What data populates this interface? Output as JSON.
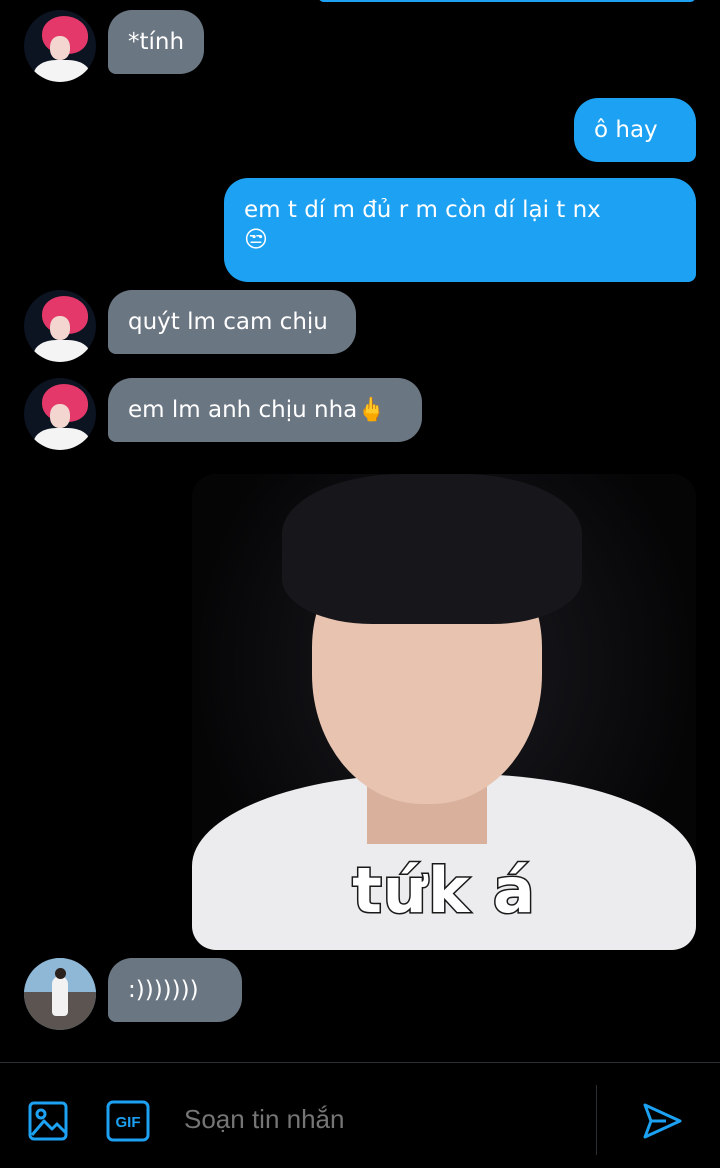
{
  "messages": [
    {
      "side": "received",
      "text": "*tính"
    },
    {
      "side": "sent",
      "text": "ô hay"
    },
    {
      "side": "sent",
      "line1": "em t dí m đủ r m còn dí lại t nx",
      "line2": "😒"
    },
    {
      "side": "received",
      "text": "quýt lm cam chịu"
    },
    {
      "side": "received",
      "text": "em lm anh chịu nha🖕"
    },
    {
      "side": "sent",
      "type": "image",
      "caption": "tứk á"
    },
    {
      "side": "received",
      "text": ":)))))))"
    }
  ],
  "composer": {
    "placeholder": "Soạn tin nhắn",
    "gif_label": "GIF",
    "icons": [
      "image-icon",
      "gif-icon",
      "send-icon"
    ]
  },
  "colors": {
    "background": "#000000",
    "sent_bubble": "#1da1f2",
    "received_bubble": "#6b7683",
    "accent": "#1da1f2"
  }
}
